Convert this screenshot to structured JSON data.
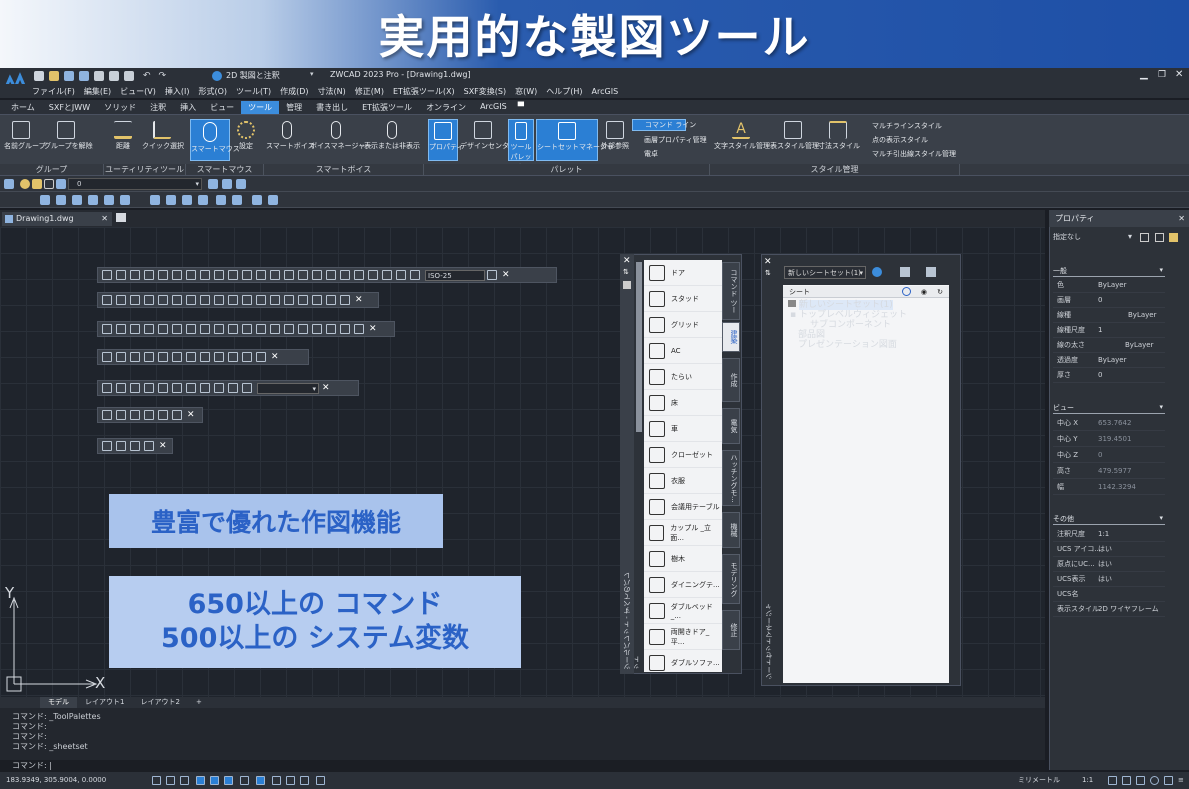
{
  "banner": {
    "title": "実用的な製図ツール"
  },
  "titlebar": {
    "workspace": "2D 製図と注釈",
    "app_title": "ZWCAD 2023 Pro - [Drawing1.dwg]"
  },
  "menu": [
    "ファイル(F)",
    "編集(E)",
    "ビュー(V)",
    "挿入(I)",
    "形式(O)",
    "ツール(T)",
    "作成(D)",
    "寸法(N)",
    "修正(M)",
    "ET拡張ツール(X)",
    "SXF変換(S)",
    "窓(W)",
    "ヘルプ(H)",
    "ArcGIS"
  ],
  "ribbon_tabs": [
    "ホーム",
    "SXFとJWW",
    "ソリッド",
    "注釈",
    "挿入",
    "ビュー",
    "ツール",
    "管理",
    "書き出し",
    "ET拡張ツール",
    "オンライン",
    "ArcGIS"
  ],
  "ribbon_active": "ツール",
  "ribbon": {
    "b_group": "名前グループ",
    "b_ungroup": "グループを解除",
    "b_distance": "距離",
    "b_quick": "クイック選択",
    "b_mouse": "スマートマウス",
    "b_settings": "設定",
    "b_voice": "スマートボイス",
    "b_voicemgr": "ボイスマネージャー",
    "b_showhide": "表示または非表示",
    "b_props": "プロパティ",
    "b_design": "デザインセンター",
    "b_toolpal": "ツール パレット",
    "b_sheetset": "シートセットマネージャ",
    "b_xref": "外部参照",
    "b_cmdline": "コマンド ライン",
    "b_layerprops": "画層プロパティ管理",
    "b_calc": "電卓",
    "b_textstyle": "文字スタイル管理",
    "b_tablestyle": "表スタイル管理",
    "b_dimstyle": "寸法スタイル",
    "b_mlstyle": "マルチラインスタイル",
    "b_ptstyle": "点の表示スタイル",
    "b_mleader": "マルチ引出線スタイル管理"
  },
  "ribbon_groups": [
    "グループ",
    "ユーティリティツール",
    "スマートマウス",
    "スマートボイス",
    "パレット",
    "スタイル管理"
  ],
  "layer_value": "0",
  "doc_tab": "Drawing1.dwg",
  "toolbar_dropdown": "ISO-25",
  "features": {
    "line1": "豊富で優れた作図機能",
    "line2": "650以上の コマンド",
    "line3": "500以上の システム変数"
  },
  "axis": {
    "y": "Y",
    "x": "X"
  },
  "tool_palette": {
    "vertical_title": "ツールパレット - すべてのパレット",
    "items": [
      "ドア",
      "スタッド",
      "グリッド",
      "AC",
      "たらい",
      "床",
      "車",
      "クローゼット",
      "衣服",
      "会議用テーブル",
      "カップル _立面...",
      "樹木",
      "ダイニングテ...",
      "ダブルベッド_...",
      "両開きドア_平...",
      "ダブルソファ..."
    ],
    "tabs": [
      "コマンド ツー",
      "建築",
      "作成",
      "電気",
      "ハッチングモ...",
      "機械",
      "モデリング",
      "修正"
    ]
  },
  "sheet_set": {
    "dropdown": "新しいシートセット(1)",
    "header": "シート",
    "tree": [
      "新しいシートセット(1)",
      "トップレベルウィジェット",
      "サブコンポーネント",
      "部品図",
      "プレゼンテーション図面"
    ],
    "vertical_title": "シートセットマネージャ"
  },
  "properties": {
    "title": "プロパティ",
    "selection": "指定なし",
    "sections": [
      {
        "name": "一般",
        "rows": [
          [
            "色",
            "ByLayer"
          ],
          [
            "画層",
            "0"
          ],
          [
            "線種",
            "ByLayer"
          ],
          [
            "線種尺度",
            "1"
          ],
          [
            "線の太さ",
            "ByLayer"
          ],
          [
            "透過度",
            "ByLayer"
          ],
          [
            "厚さ",
            "0"
          ]
        ]
      },
      {
        "name": "ビュー",
        "rows": [
          [
            "中心 X",
            "653.7642"
          ],
          [
            "中心 Y",
            "319.4501"
          ],
          [
            "中心 Z",
            "0"
          ],
          [
            "高さ",
            "479.5977"
          ],
          [
            "幅",
            "1142.3294"
          ]
        ]
      },
      {
        "name": "その他",
        "rows": [
          [
            "注釈尺度",
            "1:1"
          ],
          [
            "UCS アイコ...",
            "はい"
          ],
          [
            "原点にUC...",
            "はい"
          ],
          [
            "UCS表示",
            "はい"
          ],
          [
            "UCS名",
            ""
          ],
          [
            "表示スタイル",
            "2D ワイヤフレーム"
          ]
        ]
      }
    ]
  },
  "layout_tabs": [
    "モデル",
    "レイアウト1",
    "レイアウト2",
    "+"
  ],
  "command_history": [
    "コマンド: _ToolPalettes",
    "コマンド:",
    "コマンド:",
    "コマンド: _sheetset"
  ],
  "command_prompt": "コマンド:",
  "status": {
    "coords": "183.9349, 305.9004, 0.0000",
    "units": "ミリメートル",
    "scale": "1:1"
  }
}
